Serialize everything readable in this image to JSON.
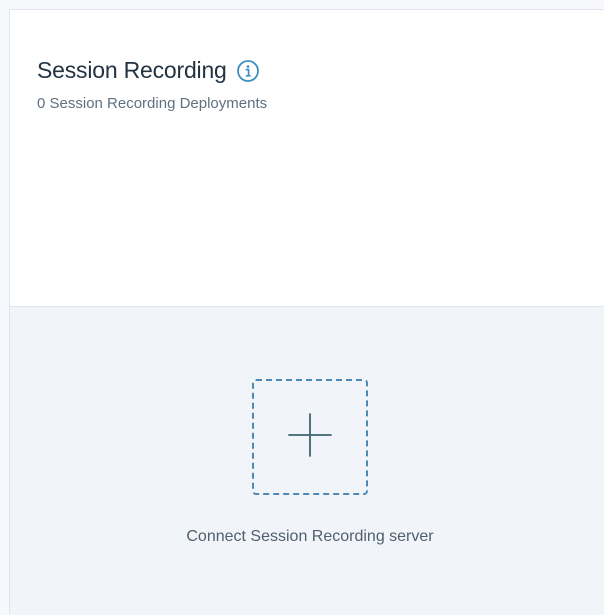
{
  "panel": {
    "title": "Session Recording",
    "subtitle": "0 Session Recording Deployments",
    "info_icon": "info-circle-icon",
    "add_icon": "plus-icon",
    "connect_label": "Connect Session Recording server"
  },
  "colors": {
    "accent": "#3f8fbf",
    "title_text": "#243342",
    "subtitle_text": "#5f7080",
    "body_background": "#f1f4f8",
    "border": "#dfe5ee",
    "dashed_border": "#4f8ab6"
  }
}
